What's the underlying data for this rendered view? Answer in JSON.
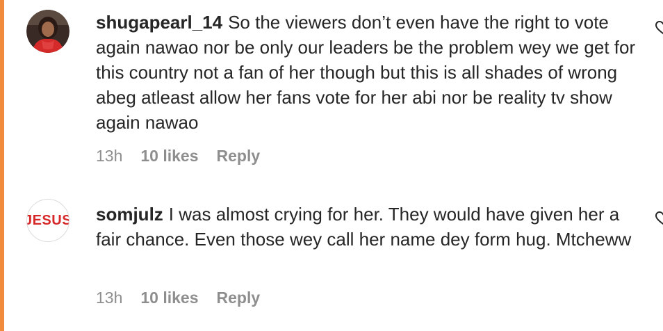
{
  "comments": [
    {
      "username": "shugapearl_14",
      "text": "So the viewers don’t even have the right to vote again nawao nor be only our leaders be the problem wey we get for this country not a fan of her though but this is all shades of wrong abeg atleast allow her fans vote for her abi nor be reality tv show again nawao",
      "time": "13h",
      "likes": "10 likes",
      "reply": "Reply"
    },
    {
      "username": "somjulz",
      "avatar_text": "JESUS",
      "text": "I was almost crying for her. They would have given her a fair chance. Even those wey call her name dey form hug. Mtcheww",
      "time": "13h",
      "likes": "10 likes",
      "reply": "Reply"
    }
  ],
  "colors": {
    "accent": "#f08a3c",
    "text": "#262626",
    "meta": "#8e8e8e",
    "avatar_text": "#d62828"
  },
  "icons": {
    "like": "heart-icon"
  }
}
